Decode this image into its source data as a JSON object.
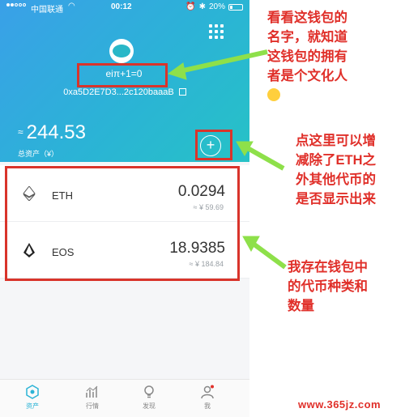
{
  "status_bar": {
    "carrier": "中国联通",
    "time": "00:12",
    "battery": "20%"
  },
  "wallet": {
    "name": "eiπ+1=0",
    "address": "0xa5D2E7D3...2c120baaaB",
    "balance_prefix": "≈",
    "balance": "244.53",
    "balance_label": "总资产（¥）"
  },
  "tokens": [
    {
      "symbol": "ETH",
      "amount": "0.0294",
      "value": "≈ ¥ 59.69"
    },
    {
      "symbol": "EOS",
      "amount": "18.9385",
      "value": "≈ ¥ 184.84"
    }
  ],
  "tabs": [
    {
      "label": "资产",
      "icon": "wallet-icon",
      "active": true
    },
    {
      "label": "行情",
      "icon": "chart-icon",
      "active": false
    },
    {
      "label": "发现",
      "icon": "bulb-icon",
      "active": false
    },
    {
      "label": "我",
      "icon": "person-icon",
      "active": false
    }
  ],
  "annotations": {
    "name_note": [
      "看看这钱包的",
      "名字，就知道",
      "这钱包的拥有",
      "者是个文化人"
    ],
    "add_note": [
      "点这里可以增",
      "减除了ETH之",
      "外其他代币的",
      "是否显示出来"
    ],
    "token_note": [
      "我存在钱包中",
      "的代币种类和",
      "数量"
    ]
  },
  "watermark": "www.365jz.com",
  "colors": {
    "accent": "#2bb3d6",
    "annotation_red": "#e0302a",
    "arrow_green": "#8ee04a"
  }
}
